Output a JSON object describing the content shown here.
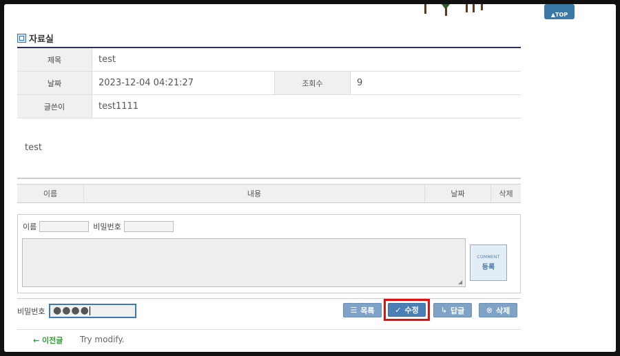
{
  "top_button": "▲TOP",
  "section": {
    "title": "자료실"
  },
  "post": {
    "labels": {
      "title": "제목",
      "date": "날짜",
      "views": "조회수",
      "author": "글쓴이"
    },
    "title": "test",
    "date": "2023-12-04 04:21:27",
    "views": "9",
    "author": "test1111",
    "content": "test"
  },
  "comments": {
    "headers": [
      "이름",
      "내용",
      "날짜",
      "삭제"
    ],
    "form": {
      "name_label": "이름",
      "password_label": "비밀번호",
      "submit_small": "COMMENT",
      "submit_big": "등록"
    }
  },
  "actions": {
    "password_label": "비밀번호",
    "password_value": "●●●●",
    "list": "목록",
    "modify": "수정",
    "reply": "답글",
    "delete": "삭제"
  },
  "nav": {
    "prev_label": "← 이전글",
    "prev_title": "Try modify."
  },
  "colors": {
    "header_border": "#2b2f66",
    "button": "#7fa3c7",
    "highlight": "#e01010",
    "prev_link": "#2f9b2f"
  }
}
